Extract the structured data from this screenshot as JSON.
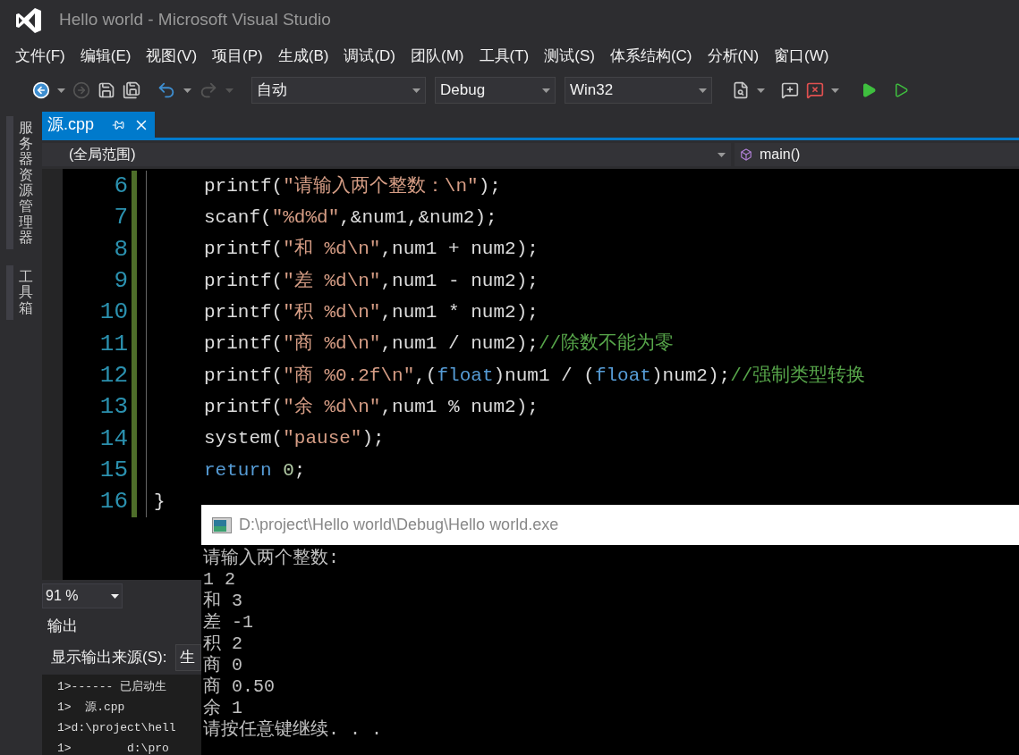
{
  "window": {
    "title": "Hello world - Microsoft Visual Studio"
  },
  "menu": [
    "文件(F)",
    "编辑(E)",
    "视图(V)",
    "项目(P)",
    "生成(B)",
    "调试(D)",
    "团队(M)",
    "工具(T)",
    "测试(S)",
    "体系结构(C)",
    "分析(N)",
    "窗口(W)"
  ],
  "toolbar": {
    "dropdowns": [
      {
        "value": "自动"
      },
      {
        "value": "Debug"
      },
      {
        "value": "Win32"
      }
    ]
  },
  "side_tabs": [
    "服务器资源管理器",
    "工具箱"
  ],
  "editor_tabs": [
    {
      "label": "源.cpp",
      "selected": true
    }
  ],
  "nav": {
    "scope": "(全局范围)",
    "member": "main()"
  },
  "code": [
    {
      "line": "6",
      "indented": true,
      "tokens": [
        {
          "kind": "plain",
          "text": "printf("
        },
        {
          "kind": "string",
          "text": "\"请输入两个整数：\\n\""
        },
        {
          "kind": "plain",
          "text": ");"
        }
      ]
    },
    {
      "line": "7",
      "indented": true,
      "tokens": [
        {
          "kind": "plain",
          "text": "scanf("
        },
        {
          "kind": "string",
          "text": "\"%d%d\""
        },
        {
          "kind": "plain",
          "text": ",&num1,&num2);"
        }
      ]
    },
    {
      "line": "8",
      "indented": true,
      "tokens": [
        {
          "kind": "plain",
          "text": "printf("
        },
        {
          "kind": "string",
          "text": "\"和 %d\\n\""
        },
        {
          "kind": "plain",
          "text": ",num1 + num2);"
        }
      ]
    },
    {
      "line": "9",
      "indented": true,
      "tokens": [
        {
          "kind": "plain",
          "text": "printf("
        },
        {
          "kind": "string",
          "text": "\"差 %d\\n\""
        },
        {
          "kind": "plain",
          "text": ",num1 - num2);"
        }
      ]
    },
    {
      "line": "10",
      "indented": true,
      "tokens": [
        {
          "kind": "plain",
          "text": "printf("
        },
        {
          "kind": "string",
          "text": "\"积 %d\\n\""
        },
        {
          "kind": "plain",
          "text": ",num1 * num2);"
        }
      ]
    },
    {
      "line": "11",
      "indented": true,
      "tokens": [
        {
          "kind": "plain",
          "text": "printf("
        },
        {
          "kind": "string",
          "text": "\"商 %d\\n\""
        },
        {
          "kind": "plain",
          "text": ",num1 / num2);"
        },
        {
          "kind": "comment",
          "text": "//除数不能为零"
        }
      ]
    },
    {
      "line": "12",
      "indented": true,
      "tokens": [
        {
          "kind": "plain",
          "text": "printf("
        },
        {
          "kind": "string",
          "text": "\"商 %0.2f\\n\""
        },
        {
          "kind": "plain",
          "text": ",("
        },
        {
          "kind": "keyword",
          "text": "float"
        },
        {
          "kind": "plain",
          "text": ")num1 / ("
        },
        {
          "kind": "keyword",
          "text": "float"
        },
        {
          "kind": "plain",
          "text": ")num2);"
        },
        {
          "kind": "comment",
          "text": "//强制类型转换"
        }
      ]
    },
    {
      "line": "13",
      "indented": true,
      "tokens": [
        {
          "kind": "plain",
          "text": "printf("
        },
        {
          "kind": "string",
          "text": "\"余 %d\\n\""
        },
        {
          "kind": "plain",
          "text": ",num1 % num2);"
        }
      ]
    },
    {
      "line": "14",
      "indented": true,
      "tokens": [
        {
          "kind": "plain",
          "text": "system("
        },
        {
          "kind": "string",
          "text": "\"pause\""
        },
        {
          "kind": "plain",
          "text": ");"
        }
      ]
    },
    {
      "line": "15",
      "indented": true,
      "tokens": [
        {
          "kind": "keyword",
          "text": "return"
        },
        {
          "kind": "number",
          "text": " 0"
        },
        {
          "kind": "plain",
          "text": ";"
        }
      ]
    },
    {
      "line": "16",
      "indented": false,
      "tokens": [
        {
          "kind": "plain",
          "text": "}"
        }
      ]
    }
  ],
  "zoom": "91 %",
  "output": {
    "title": "输出",
    "source_label": "显示输出来源(S):",
    "source_value": "生",
    "lines": [
      "1>------ 已启动生",
      "1>  源.cpp",
      "1>d:\\project\\hell",
      "1>        d:\\pro"
    ]
  },
  "console": {
    "title": "D:\\project\\Hello world\\Debug\\Hello world.exe",
    "lines": [
      "请输入两个整数:",
      "1 2",
      "和 3",
      "差 -1",
      "积 2",
      "商 0",
      "商 0.50",
      "余 1",
      "请按任意键继续. . ."
    ]
  }
}
